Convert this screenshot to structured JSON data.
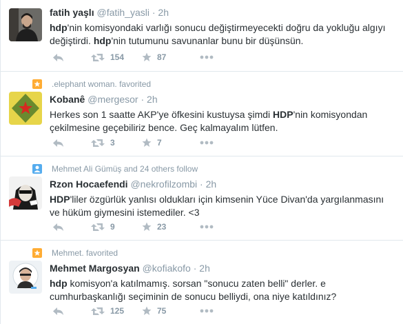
{
  "colors": {
    "text": "#292f33",
    "muted": "#8899a6",
    "icon": "#b1bbc3",
    "border": "#e1e8ed",
    "star": "#ffac33",
    "follow": "#55acee"
  },
  "tweets": [
    {
      "context": "",
      "name": "fatih yaşlı",
      "handle": "@fatih_yasli",
      "sep": "·",
      "time": "2h",
      "text_line1_bold": "hdp",
      "text_line1_rest": "'nin komisyondaki varlığı sonucu değiştirmeyecekti doğru da yokluğu algıyı",
      "text_line2_a": "değiştirdi. ",
      "text_line2_bold": "hdp",
      "text_line2_rest": "'nin tutumunu savunanlar bunu bir düşünsün.",
      "retweets": "154",
      "favorites": "87"
    },
    {
      "context": ".elephant woman. favorited",
      "name": "Kobanê",
      "handle": "@mergesor",
      "sep": "·",
      "time": "2h",
      "text_line1_a": "Herkes son 1 saatte AKP'ye öfkesini kustuysa şimdi ",
      "text_line1_bold": "HDP",
      "text_line1_rest": "'nin komisyondan",
      "text_line2": "çekilmesine geçebiliriz bence. Geç kalmayalım lütfen.",
      "retweets": "3",
      "favorites": "7"
    },
    {
      "context": "Mehmet Ali Gümüş and 24 others follow",
      "name": "Rzon Hocaefendi",
      "handle": "@nekrofilzombi",
      "sep": "·",
      "time": "2h",
      "text_line1_bold": "HDP",
      "text_line1_rest": "'liler özgürlük yanlısı oldukları için kimsenin Yüce Divan'da yargılanmasını",
      "text_line2": "ve hüküm giymesini istemediler. <3",
      "retweets": "9",
      "favorites": "23"
    },
    {
      "context": "Mehmet. favorited",
      "name": "Mehmet Margosyan",
      "handle": "@kofiakofo",
      "sep": "·",
      "time": "2h",
      "text_line1_bold": "hdp",
      "text_line1_rest": " komisyon'a katılmamış. sorsan \"sonucu zaten belli\" derler. e",
      "text_line2": "cumhurbaşkanlığı seçiminin de sonucu belliydi, ona niye katıldınız?",
      "retweets": "125",
      "favorites": "75"
    }
  ]
}
